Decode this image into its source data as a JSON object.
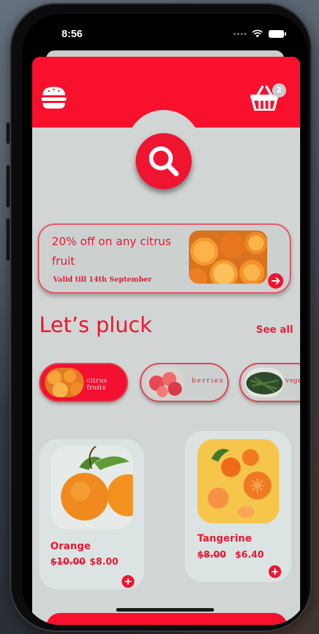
{
  "status_bar": {
    "time": "8:56"
  },
  "header": {
    "cart_count": "2",
    "brand_color": "#f8102c"
  },
  "promo": {
    "title": "20% off on any citrus fruit",
    "valid_text": "Valid till 14th September"
  },
  "section": {
    "title": "Let’s pluck",
    "see_all": "See all"
  },
  "categories": [
    {
      "label": "citrus fruits",
      "selected": true
    },
    {
      "label": "berries",
      "selected": false
    },
    {
      "label": "vegetab",
      "selected": false
    }
  ],
  "products": [
    {
      "name": "Orange",
      "old_price": "$10.00",
      "new_price": "$8.00"
    },
    {
      "name": "Tangerine",
      "old_price": "$8.00",
      "new_price": "$6.40"
    }
  ],
  "icons": [
    "menu-burger-icon",
    "basket-icon",
    "search-icon",
    "arrow-right-icon",
    "plus-icon"
  ]
}
